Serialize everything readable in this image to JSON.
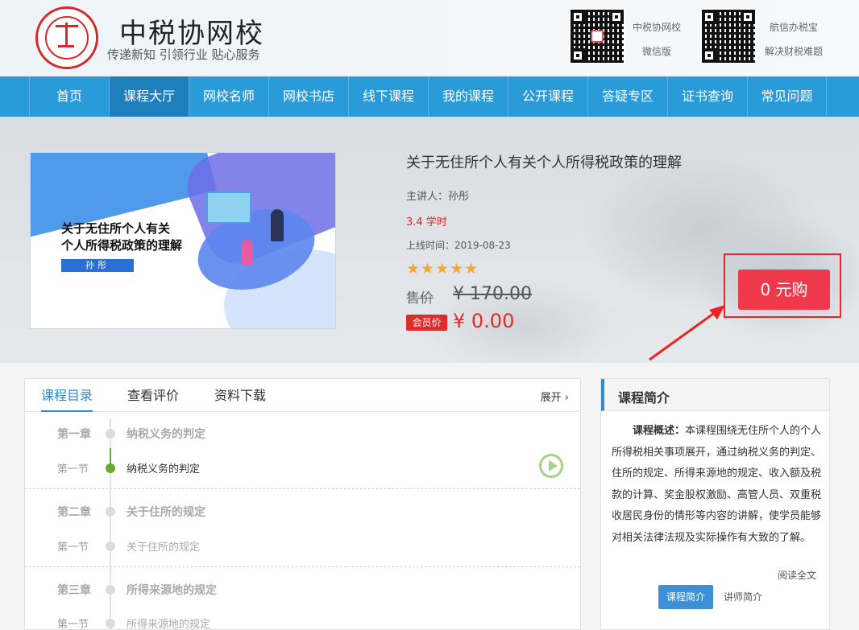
{
  "header": {
    "site_title": "中税协网校",
    "slogan": "传递新知 引领行业 贴心服务",
    "qr_codes": [
      {
        "line1": "中税协网校",
        "line2": "微信版"
      },
      {
        "line1": "航信办税宝",
        "line2": "解决财税难题"
      }
    ]
  },
  "nav": {
    "items": [
      "首页",
      "课程大厅",
      "网校名师",
      "网校书店",
      "线下课程",
      "我的课程",
      "公开课程",
      "答疑专区",
      "证书查询",
      "常见问题"
    ],
    "active": "课程大厅"
  },
  "course": {
    "cover_title_line1": "关于无住所个人有关",
    "cover_title_line2": "个人所得税政策的理解",
    "cover_tag": "孙彤",
    "title": "关于无住所个人有关个人所得税政策的理解",
    "lecturer": "主讲人：孙彤",
    "hours": "3.4 学时",
    "online_date": "上线时间：2019-08-23",
    "rating": 5,
    "stars_text": "★★★★★",
    "price_label": "售价",
    "price_old": "¥ 170.00",
    "member_label": "会员价",
    "member_price": "¥ 0.00",
    "buy_label": "0 元购"
  },
  "catalog": {
    "tabs": [
      "课程目录",
      "查看评价",
      "资料下载"
    ],
    "expand": "展开 ›",
    "rows": [
      {
        "label": "第一章",
        "text": "纳税义务的判定",
        "type": "chapter"
      },
      {
        "label": "第一节",
        "text": "纳税义务的判定",
        "type": "section",
        "current": true
      },
      {
        "label": "第二章",
        "text": "关于住所的规定",
        "type": "chapter"
      },
      {
        "label": "第一节",
        "text": "关于住所的规定",
        "type": "section"
      },
      {
        "label": "第三章",
        "text": "所得来源地的规定",
        "type": "chapter"
      },
      {
        "label": "第一节",
        "text": "所得来源地的规定",
        "type": "section"
      }
    ]
  },
  "intro": {
    "heading": "课程简介",
    "lead": "课程概述：",
    "body": "本课程围绕无住所个人的个人所得税相关事项展开，通过纳税义务的判定、住所的规定、所得来源地的规定、收入额及税款的计算、奖金股权激励、高管人员、双重税收居民身份的情形等内容的讲解，使学员能够对相关法律法规及实际操作有大致的了解。",
    "read_more": "阅读全文",
    "btn_course": "课程简介",
    "btn_teacher": "讲师简介"
  },
  "colors": {
    "nav": "#2b9ad8",
    "nav_active": "#1f7fbd",
    "buy": "#f0384d",
    "accent": "#2b8ad1",
    "highlight_frame": "#ee2222"
  }
}
